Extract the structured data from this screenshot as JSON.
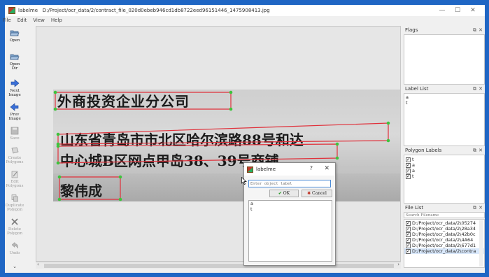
{
  "window": {
    "app_name": "labelme",
    "path": "D:/Project/ocr_data/2/contract_file_020d0ebeb946cd1db8722eed96151446_1475908413.jpg",
    "min": "—",
    "max": "☐",
    "close": "✕"
  },
  "menu": [
    "File",
    "Edit",
    "View",
    "Help"
  ],
  "toolbar": [
    {
      "label": "Open",
      "icon": "folder-open-icon",
      "enabled": true
    },
    {
      "label": "Open\nDir",
      "icon": "folder-icon",
      "enabled": true
    },
    {
      "label": "Next\nImage",
      "icon": "arrow-right-icon",
      "enabled": true
    },
    {
      "label": "Prev\nImage",
      "icon": "arrow-left-icon",
      "enabled": true
    },
    {
      "label": "Save",
      "icon": "floppy-disk-icon",
      "enabled": false
    },
    {
      "label": "Create\nPolygons",
      "icon": "polygon-icon",
      "enabled": false
    },
    {
      "label": "Edit\nPolygons",
      "icon": "edit-icon",
      "enabled": false
    },
    {
      "label": "Duplicate\nPolygon",
      "icon": "copy-icon",
      "enabled": false
    },
    {
      "label": "Delete\nPolygon",
      "icon": "delete-icon",
      "enabled": false
    },
    {
      "label": "Undo",
      "icon": "undo-icon",
      "enabled": false
    }
  ],
  "canvas": {
    "lines": [
      "外商投资企业分公司",
      "山东省青岛市市北区哈尔滨路88号和达",
      "中心城B区网点甲岛38、39号商铺",
      "黎伟成"
    ],
    "polygon_color": "#e0303a",
    "vertex_color": "#3cc43c"
  },
  "docks": {
    "flags": {
      "title": "Flags"
    },
    "label_list": {
      "title": "Label List",
      "items": [
        "a",
        "t"
      ]
    },
    "polygon_labels": {
      "title": "Polygon Labels",
      "items": [
        "t",
        "a",
        "a",
        "t"
      ]
    },
    "file_list": {
      "title": "File List",
      "search_placeholder": "Search Filename",
      "items": [
        "D:/Project/ocr_data/2\\05274",
        "D:/Project/ocr_data/2\\28a34",
        "D:/Project/ocr_data/2\\42b0c",
        "D:/Project/ocr_data/2\\4A64",
        "D:/Project/ocr_data/2\\677d1",
        "D:/Project/ocr_data/2\\contra"
      ]
    }
  },
  "dialog": {
    "title": "labelme",
    "help": "?",
    "close": "✕",
    "placeholder": "Enter object label",
    "ok_label": "OK",
    "cancel_label": "Cancel",
    "labels": [
      "a",
      "t"
    ]
  }
}
